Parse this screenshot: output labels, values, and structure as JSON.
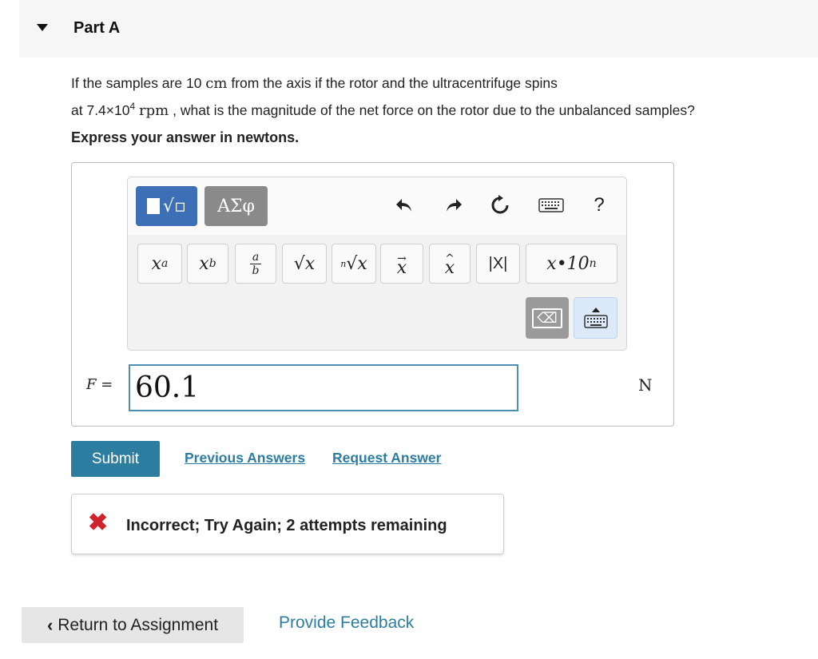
{
  "part": {
    "title": "Part A"
  },
  "question": {
    "line1_a": "If the samples are 10",
    "unit_cm": "cm",
    "line1_b": "from the axis if the rotor and the ultracentrifuge spins",
    "line2_a": "at 7.4×10",
    "exponent": "4",
    "unit_rpm": "rpm",
    "line2_b": ", what is the magnitude of the net force on the rotor due to the unbalanced samples?",
    "instruction": "Express your answer in newtons."
  },
  "toolbar": {
    "templates_icon": "templates-sqrt-icon",
    "greek_label": "ΑΣφ",
    "undo_icon": "undo-icon",
    "redo_icon": "redo-icon",
    "reset_icon": "reset-icon",
    "keyboard_icon": "keyboard-icon",
    "help_label": "?",
    "keys": [
      "x^a",
      "x_b",
      "a/b",
      "√x",
      "ⁿ√x",
      "vector x",
      "unit x",
      "|X|",
      "x•10ⁿ"
    ],
    "abs_label": "|X|",
    "sci_label": "x•10",
    "sci_exp": "n",
    "delete_icon": "backspace-icon",
    "keyboard_toggle_icon": "keyboard-toggle-icon"
  },
  "answer": {
    "variable": "F",
    "equals": "=",
    "value": "60.1",
    "unit": "N"
  },
  "actions": {
    "submit_label": "Submit",
    "previous_answers_label": "Previous Answers",
    "request_answer_label": "Request Answer"
  },
  "feedback": {
    "status_icon": "x-mark-icon",
    "message": "Incorrect; Try Again; 2 attempts remaining",
    "color": "#d0232c"
  },
  "footer": {
    "return_label": "Return to Assignment",
    "provide_feedback_label": "Provide Feedback"
  },
  "colors": {
    "accent": "#2d7da1",
    "template_button": "#3c6fb6",
    "greek_button": "#8a8a8a"
  }
}
